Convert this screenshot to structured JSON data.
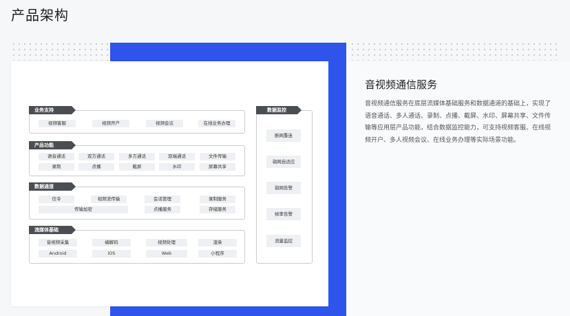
{
  "page_title": "产品架构",
  "diagram": {
    "groups": [
      {
        "title": "业务支持",
        "chips": [
          "视频客服",
          "视频开户",
          "视频会议",
          "在线业务办理"
        ]
      },
      {
        "title": "产品功能",
        "chips": [
          "语音通话",
          "双方通话",
          "多方通话",
          "双端通话",
          "文件传输",
          "录制",
          "点播",
          "截屏",
          "水印",
          "屏幕共享"
        ]
      },
      {
        "title": "数据通道",
        "chips": [
          "信令",
          "视频流传输",
          "会话管理",
          "录制服务",
          "传输加密",
          "点播服务",
          "存储服务"
        ]
      },
      {
        "title": "流媒体基础",
        "chips": [
          "音视频采集",
          "编解码",
          "视频处理",
          "渲染",
          "Android",
          "iOS",
          "Web",
          "小程序"
        ]
      }
    ],
    "monitor": {
      "title": "数据监控",
      "chips": [
        "断网重连",
        "弱网自适应",
        "弱网告警",
        "帧率告警",
        "流量监控"
      ]
    }
  },
  "section": {
    "heading": "音视频通信服务",
    "description": "音视频通信服务在底层流媒体基础服务和数据通道的基础上，实现了语音通话、多人通话、录制、点播、截屏、水印、屏幕共享、文件传输等应用层产品功能，结合数据监控能力，可支持视频客服、在线视频开户、多人视频会议、在线业务办理等实际场景功能。"
  },
  "colors": {
    "accent": "#2f54eb",
    "label_bg": "#4a4d52",
    "chip_bg": "#eef0f3"
  }
}
